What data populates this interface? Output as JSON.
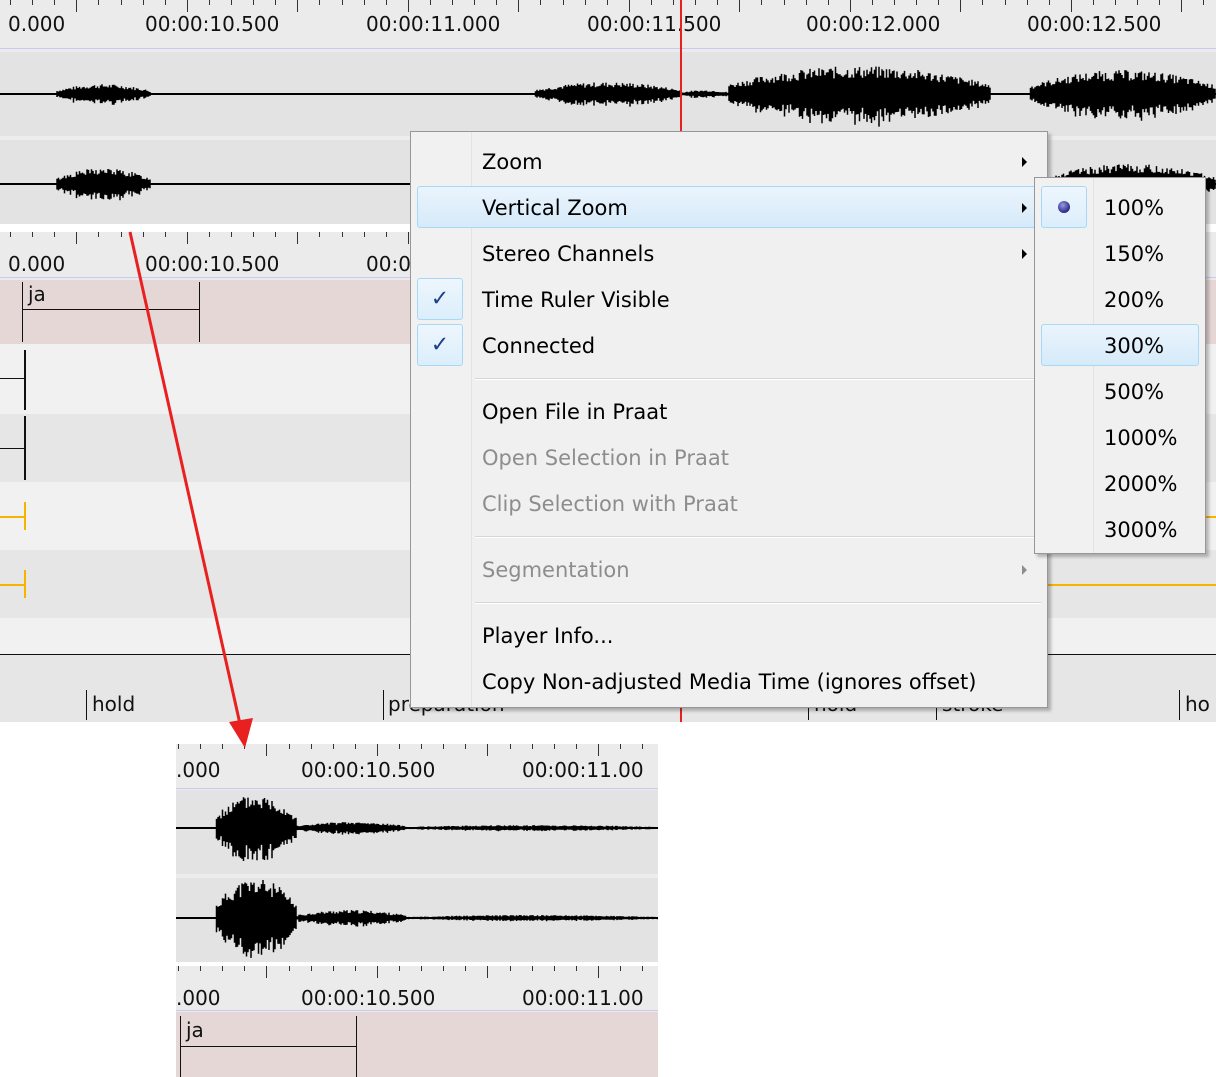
{
  "top_ruler": {
    "labels": [
      "0.000",
      "00:00:10.500",
      "00:00:11.000",
      "00:00:11.500",
      "00:00:12.000",
      "00:00:12.500"
    ]
  },
  "mid_ruler": {
    "labels": [
      "0.000",
      "00:00:10.500",
      "00:0"
    ]
  },
  "tiers": {
    "ja_label": "ja",
    "bottom_labels": [
      "hold",
      "preparation",
      "hold",
      "stroke",
      "ho"
    ]
  },
  "context_menu": {
    "items": [
      {
        "label": "Zoom",
        "submenu": true,
        "enabled": true,
        "checked": false
      },
      {
        "label": "Vertical Zoom",
        "submenu": true,
        "enabled": true,
        "checked": false,
        "highlighted": true
      },
      {
        "label": "Stereo Channels",
        "submenu": true,
        "enabled": true,
        "checked": false
      },
      {
        "label": "Time Ruler Visible",
        "submenu": false,
        "enabled": true,
        "checked": true
      },
      {
        "label": "Connected",
        "submenu": false,
        "enabled": true,
        "checked": true
      },
      {
        "label": "Open File in Praat",
        "submenu": false,
        "enabled": true,
        "checked": false
      },
      {
        "label": "Open Selection in Praat",
        "submenu": false,
        "enabled": false,
        "checked": false
      },
      {
        "label": "Clip Selection with Praat",
        "submenu": false,
        "enabled": false,
        "checked": false
      },
      {
        "label": "Segmentation",
        "submenu": true,
        "enabled": false,
        "checked": false
      },
      {
        "label": "Player Info...",
        "submenu": false,
        "enabled": true,
        "checked": false
      },
      {
        "label": "Copy Non-adjusted Media Time (ignores offset)",
        "submenu": false,
        "enabled": true,
        "checked": false
      }
    ],
    "check_glyph": "✓"
  },
  "zoom_submenu": {
    "options": [
      "100%",
      "150%",
      "200%",
      "300%",
      "500%",
      "1000%",
      "2000%",
      "3000%"
    ],
    "selected": "100%",
    "hovered": "300%"
  },
  "inset": {
    "ruler1_labels": [
      ".000",
      "00:00:10.500",
      "00:00:11.00"
    ],
    "ruler2_labels": [
      ".000",
      "00:00:10.500",
      "00:00:11.00"
    ],
    "ja_label": "ja"
  },
  "colors": {
    "cursor": "#e82020",
    "arrow": "#e82020",
    "tier_pink": "#e6d7d7",
    "grey_band": "#e3e3e3",
    "orange_mark": "#f4b400",
    "check": "#1c3f8a",
    "radio": "#3a3aa0"
  },
  "icons": {
    "submenu_arrow": "chevron-right-icon",
    "check": "check-icon",
    "radio": "radio-dot-icon"
  }
}
